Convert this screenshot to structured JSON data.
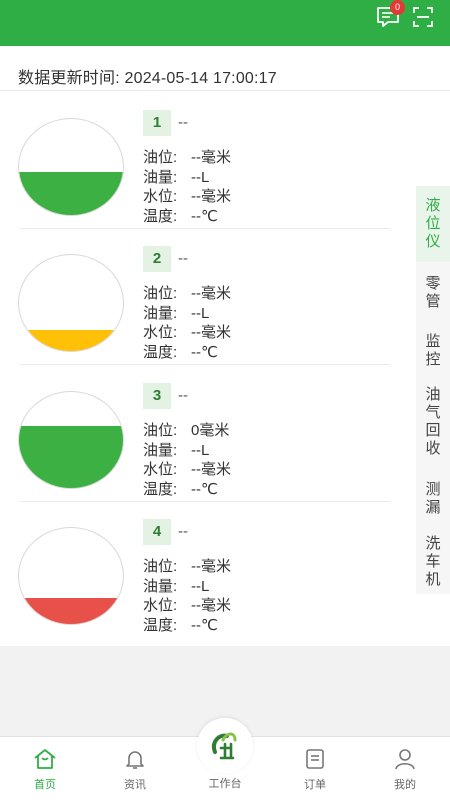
{
  "header": {
    "message_badge": "0"
  },
  "updated_text": "数据更新时间: 2024-05-14 17:00:17",
  "field_labels": {
    "oil_level": "油位:",
    "oil_volume": "油量:",
    "water_level": "水位:",
    "temperature": "温度:"
  },
  "tanks": [
    {
      "number": "1",
      "name": "--",
      "oil_level": "--毫米",
      "oil_volume": "--L",
      "water_level": "--毫米",
      "temperature": "--℃",
      "fill_fraction": 0.45,
      "fill_color": "#3cb043"
    },
    {
      "number": "2",
      "name": "--",
      "oil_level": "--毫米",
      "oil_volume": "--L",
      "water_level": "--毫米",
      "temperature": "--℃",
      "fill_fraction": 0.22,
      "fill_color": "#ffc107"
    },
    {
      "number": "3",
      "name": "--",
      "oil_level": "0毫米",
      "oil_volume": "--L",
      "water_level": "--毫米",
      "temperature": "--℃",
      "fill_fraction": 0.65,
      "fill_color": "#3cb043"
    },
    {
      "number": "4",
      "name": "--",
      "oil_level": "--毫米",
      "oil_volume": "--L",
      "water_level": "--毫米",
      "temperature": "--℃",
      "fill_fraction": 0.27,
      "fill_color": "#e8504a"
    }
  ],
  "side_tabs": [
    {
      "label": "液位仪",
      "active": true
    },
    {
      "label": "零管",
      "active": false
    },
    {
      "label": "监控",
      "active": false
    },
    {
      "label": "油气回收",
      "active": false
    },
    {
      "label": "测漏",
      "active": false
    },
    {
      "label": "洗车机",
      "active": false
    }
  ],
  "bottom_nav": {
    "home": "首页",
    "news": "资讯",
    "workbench": "工作台",
    "orders": "订单",
    "mine": "我的"
  },
  "colors": {
    "brand": "#2fae45",
    "badge": "#e53935"
  }
}
